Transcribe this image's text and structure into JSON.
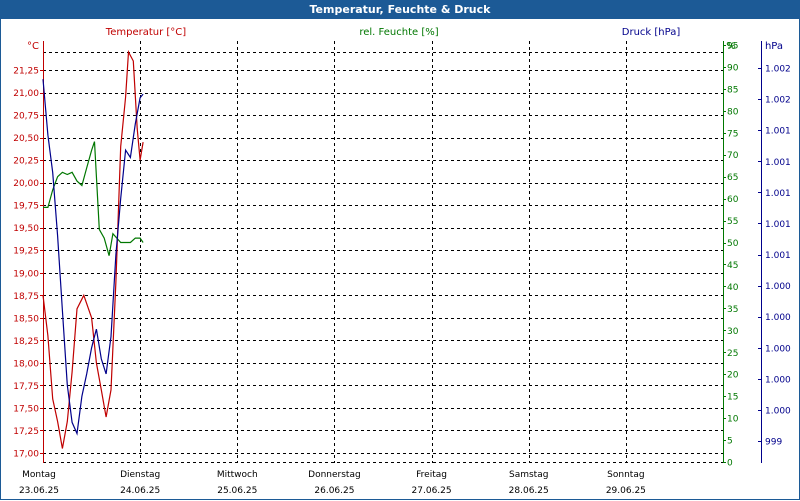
{
  "window": {
    "title": "Temperatur, Feuchte & Druck"
  },
  "chart_data": {
    "type": "line",
    "title": "Temperatur, Feuchte & Druck",
    "colors": {
      "temperature": "#c00000",
      "humidity": "#007700",
      "pressure": "#00008b",
      "title_bar": "#1c5a96",
      "grid": "#000000"
    },
    "grid": "dashed",
    "x_labels": [
      {
        "day": "Montag",
        "date": "23.06.25"
      },
      {
        "day": "Dienstag",
        "date": "24.06.25"
      },
      {
        "day": "Mittwoch",
        "date": "25.06.25"
      },
      {
        "day": "Donnerstag",
        "date": "26.06.25"
      },
      {
        "day": "Freitag",
        "date": "27.06.25"
      },
      {
        "day": "Samstag",
        "date": "28.06.25"
      },
      {
        "day": "Sonntag",
        "date": "29.06.25"
      }
    ],
    "x_range": [
      0,
      7
    ],
    "axes": {
      "temperature": {
        "label": "Temperatur [°C]",
        "unit": "°C",
        "ylim": [
          17.0,
          21.25
        ],
        "ticks": [
          "21,25",
          "21,00",
          "20,75",
          "20,50",
          "20,25",
          "20,00",
          "19,75",
          "19,50",
          "19,25",
          "19,00",
          "18,75",
          "18,50",
          "18,25",
          "18,00",
          "17,75",
          "17,50",
          "17,25",
          "17,00"
        ]
      },
      "humidity": {
        "label": "rel. Feuchte [%]",
        "unit": "%",
        "ylim": [
          0,
          95
        ],
        "ticks": [
          "95",
          "90",
          "85",
          "80",
          "75",
          "70",
          "65",
          "60",
          "55",
          "50",
          "45",
          "40",
          "35",
          "30",
          "25",
          "20",
          "15",
          "10",
          "5",
          "0"
        ]
      },
      "pressure": {
        "label": "Druck [hPa]",
        "unit": "hPa",
        "ticks": [
          "1.002",
          "1.002",
          "1.001",
          "1.001",
          "1.001",
          "1.001",
          "1.001",
          "1.000",
          "1.000",
          "1.000",
          "1.000",
          "1.000",
          "999"
        ]
      }
    },
    "series": [
      {
        "name": "Temperatur [°C]",
        "axis": "temperature",
        "points": [
          [
            0.0,
            18.75
          ],
          [
            0.05,
            18.3
          ],
          [
            0.1,
            17.6
          ],
          [
            0.15,
            17.35
          ],
          [
            0.2,
            17.05
          ],
          [
            0.25,
            17.35
          ],
          [
            0.3,
            17.9
          ],
          [
            0.35,
            18.6
          ],
          [
            0.42,
            18.75
          ],
          [
            0.5,
            18.5
          ],
          [
            0.55,
            18.0
          ],
          [
            0.6,
            17.7
          ],
          [
            0.65,
            17.4
          ],
          [
            0.7,
            17.7
          ],
          [
            0.75,
            18.9
          ],
          [
            0.8,
            20.4
          ],
          [
            0.85,
            20.95
          ],
          [
            0.88,
            21.45
          ],
          [
            0.93,
            21.35
          ],
          [
            0.97,
            20.6
          ],
          [
            1.0,
            20.25
          ],
          [
            1.03,
            20.45
          ]
        ]
      },
      {
        "name": "rel. Feuchte [%]",
        "axis": "humidity",
        "points": [
          [
            0.0,
            58
          ],
          [
            0.05,
            58
          ],
          [
            0.1,
            62
          ],
          [
            0.15,
            65
          ],
          [
            0.2,
            66
          ],
          [
            0.25,
            65.5
          ],
          [
            0.3,
            66
          ],
          [
            0.35,
            64
          ],
          [
            0.4,
            63
          ],
          [
            0.45,
            67
          ],
          [
            0.5,
            71
          ],
          [
            0.53,
            73
          ],
          [
            0.58,
            53
          ],
          [
            0.63,
            51
          ],
          [
            0.68,
            47
          ],
          [
            0.72,
            52
          ],
          [
            0.76,
            51
          ],
          [
            0.8,
            50
          ],
          [
            0.85,
            50
          ],
          [
            0.9,
            50
          ],
          [
            0.95,
            51
          ],
          [
            1.0,
            51
          ],
          [
            1.03,
            50
          ]
        ]
      },
      {
        "name": "Druck [hPa]",
        "axis": "pressure",
        "points": [
          [
            0.0,
            0.97
          ],
          [
            0.05,
            0.82
          ],
          [
            0.1,
            0.72
          ],
          [
            0.15,
            0.55
          ],
          [
            0.2,
            0.35
          ],
          [
            0.25,
            0.15
          ],
          [
            0.3,
            0.05
          ],
          [
            0.35,
            0.02
          ],
          [
            0.4,
            0.12
          ],
          [
            0.45,
            0.18
          ],
          [
            0.5,
            0.25
          ],
          [
            0.52,
            0.27
          ],
          [
            0.55,
            0.3
          ],
          [
            0.6,
            0.22
          ],
          [
            0.65,
            0.18
          ],
          [
            0.7,
            0.28
          ],
          [
            0.75,
            0.5
          ],
          [
            0.8,
            0.65
          ],
          [
            0.85,
            0.78
          ],
          [
            0.9,
            0.76
          ],
          [
            0.95,
            0.85
          ],
          [
            1.0,
            0.92
          ],
          [
            1.03,
            0.93
          ]
        ]
      }
    ]
  }
}
